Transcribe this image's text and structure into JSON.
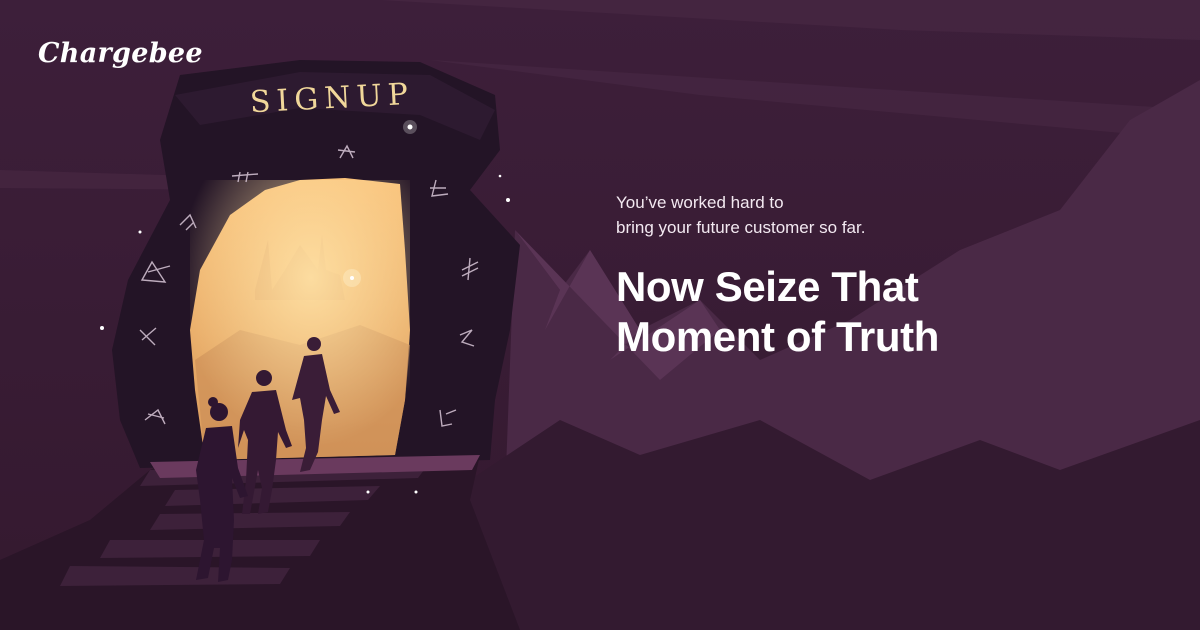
{
  "brand": {
    "name": "Chargebee"
  },
  "portal": {
    "title": "SIGNUP"
  },
  "hero": {
    "subtitle_lines": [
      "You’ve worked hard to",
      "bring your future customer so far."
    ],
    "headline_lines": [
      "Now Seize That",
      "Moment of Truth"
    ]
  },
  "colors": {
    "background": "#3b2038",
    "mountain": "#4e2c49",
    "mountain_dark": "#2a1528",
    "portal_glow": "#f7c27a",
    "rock": "#231426",
    "text": "#ffffff"
  },
  "icons": [
    "portal-rune-icon",
    "sparkle-icon",
    "star-icon"
  ]
}
